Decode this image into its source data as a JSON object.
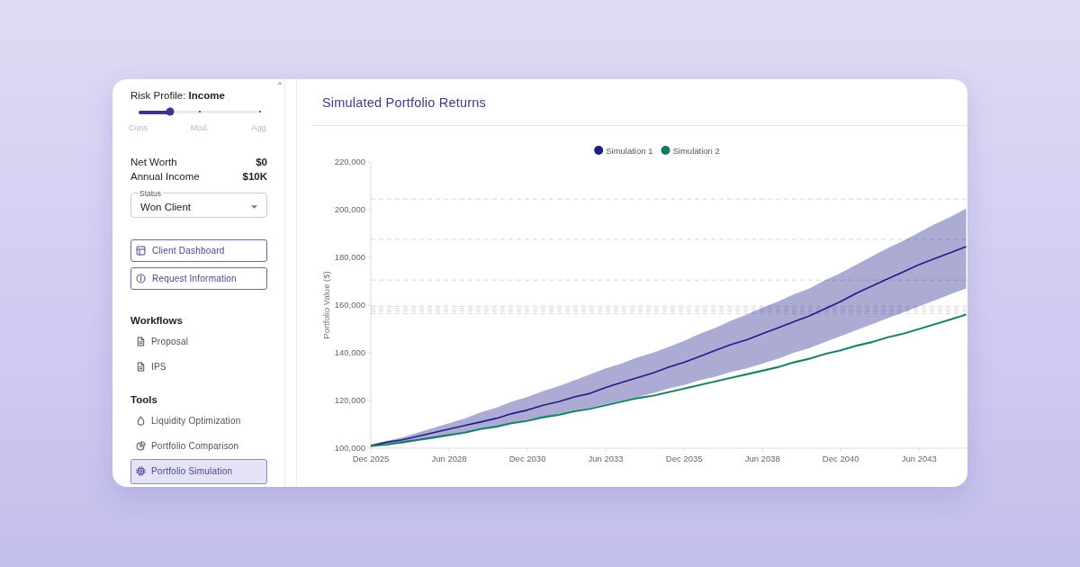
{
  "sidebar": {
    "risk_profile": {
      "label": "Risk Profile: **Income**",
      "level": 0.26,
      "ticks": [
        "Cons",
        "Mod.",
        "Agg."
      ]
    },
    "summary": [
      {
        "label": "Net Worth",
        "value": "$0"
      },
      {
        "label": "Annual Income",
        "value": "$10K"
      }
    ],
    "status_select": {
      "label": "Status",
      "value": "Won Client"
    },
    "actions": [
      {
        "label": "Client Dashboard"
      },
      {
        "label": "Request Information"
      }
    ],
    "sections": [
      {
        "title": "Workflows",
        "items": [
          {
            "label": "Proposal",
            "selected": false
          },
          {
            "label": "IPS",
            "selected": false
          }
        ]
      },
      {
        "title": "Tools",
        "items": [
          {
            "label": "Liquidity Optimization",
            "selected": false
          },
          {
            "label": "Portfolio Comparison",
            "selected": false
          },
          {
            "label": "Portfolio Simulation",
            "selected": true
          }
        ]
      }
    ]
  },
  "main": {
    "title": "Simulated Portfolio Returns",
    "chart_data": {
      "type": "line",
      "ylabel": "Portfolio Value ($)",
      "legend": "top",
      "categories": [
        "Dec 2025",
        null,
        null,
        null,
        null,
        "Jun 2028",
        null,
        null,
        null,
        null,
        "Dec 2030",
        null,
        null,
        null,
        null,
        "Jun 2033",
        null,
        null,
        null,
        null,
        "Dec 2035",
        null,
        null,
        null,
        null,
        "Jun 2038",
        null,
        null,
        null,
        null,
        "Dec 2040",
        null,
        null,
        null,
        null,
        "Jun 2043",
        null,
        null,
        null
      ],
      "ylim": [
        100000,
        220000
      ],
      "yticks": [
        {
          "value": 100000,
          "label": "100,000"
        },
        {
          "value": 120000,
          "label": "120,000"
        },
        {
          "value": 140000,
          "label": "140,000"
        },
        {
          "value": 160000,
          "label": "160,000"
        },
        {
          "value": 180000,
          "label": "180,000"
        },
        {
          "value": 200000,
          "label": "200,000"
        },
        {
          "value": 220000,
          "label": "220,000"
        }
      ],
      "series": [
        {
          "name": "Simulation 1",
          "color": "#1f1c88",
          "values": [
            101000,
            102500,
            103500,
            105000,
            106500,
            108000,
            109500,
            111000,
            112500,
            114500,
            116000,
            118000,
            119500,
            121500,
            123000,
            125500,
            127500,
            129500,
            131500,
            134000,
            136000,
            138500,
            141000,
            143500,
            145500,
            148000,
            150500,
            153000,
            155500,
            158500,
            161500,
            165000,
            168000,
            171000,
            174000,
            177000,
            179500,
            182000,
            184500
          ],
          "lower": [
            100500,
            101500,
            102000,
            103000,
            104000,
            105500,
            106500,
            108000,
            109000,
            110500,
            112000,
            113000,
            114500,
            116000,
            117000,
            118500,
            120000,
            121500,
            123000,
            125000,
            126500,
            128500,
            130000,
            132000,
            133500,
            135500,
            137500,
            140000,
            142000,
            144500,
            147000,
            149500,
            152000,
            154500,
            157000,
            159500,
            162000,
            164500,
            167000
          ],
          "upper": [
            101500,
            103000,
            104500,
            106500,
            108500,
            110500,
            112500,
            115000,
            117000,
            119500,
            121500,
            124000,
            126000,
            128500,
            131000,
            133500,
            135500,
            138000,
            140000,
            142500,
            145000,
            148000,
            150500,
            153500,
            156000,
            159000,
            161500,
            164500,
            167000,
            170500,
            173500,
            177000,
            180500,
            184000,
            187000,
            190500,
            194000,
            197000,
            200500
          ]
        },
        {
          "name": "Simulation 2",
          "color": "#127a63",
          "values": [
            101000,
            101500,
            102500,
            103500,
            104500,
            105500,
            106500,
            108000,
            109000,
            110500,
            111500,
            113000,
            114000,
            115500,
            116500,
            118000,
            119500,
            121000,
            122000,
            123500,
            125000,
            126500,
            128000,
            129500,
            131000,
            132500,
            134000,
            136000,
            137500,
            139500,
            141000,
            143000,
            144500,
            146500,
            148000,
            150000,
            152000,
            154000,
            156000
          ],
          "lower": [
            100500,
            101000,
            102000,
            103000,
            104000,
            105000,
            106000,
            107500,
            108500,
            110000,
            111000,
            112500,
            113500,
            115000,
            116000,
            117500,
            119000,
            120500,
            121500,
            123000,
            124500,
            126000,
            127500,
            129000,
            130500,
            132000,
            133500,
            135500,
            137000,
            139000,
            140500,
            142500,
            144000,
            146000,
            147500,
            149500,
            151500,
            153500,
            155500
          ],
          "upper": [
            101500,
            102000,
            103000,
            104000,
            105000,
            106000,
            107000,
            108500,
            109500,
            111000,
            112000,
            113500,
            114500,
            116000,
            117000,
            118500,
            120000,
            121500,
            122500,
            124000,
            125500,
            127000,
            128500,
            130000,
            131500,
            133000,
            134500,
            136500,
            138000,
            140000,
            141500,
            143500,
            145000,
            147000,
            148500,
            150500,
            152500,
            154500,
            156500
          ]
        }
      ],
      "ref_lines": [
        {
          "axis": "y",
          "value": 204500
        },
        {
          "axis": "y",
          "value": 187500
        },
        {
          "axis": "y",
          "value": 170500
        },
        {
          "axis": "y",
          "value": 159500
        },
        {
          "axis": "y",
          "value": 158500
        },
        {
          "axis": "y",
          "value": 157500
        },
        {
          "axis": "y",
          "value": 156500
        }
      ]
    }
  }
}
